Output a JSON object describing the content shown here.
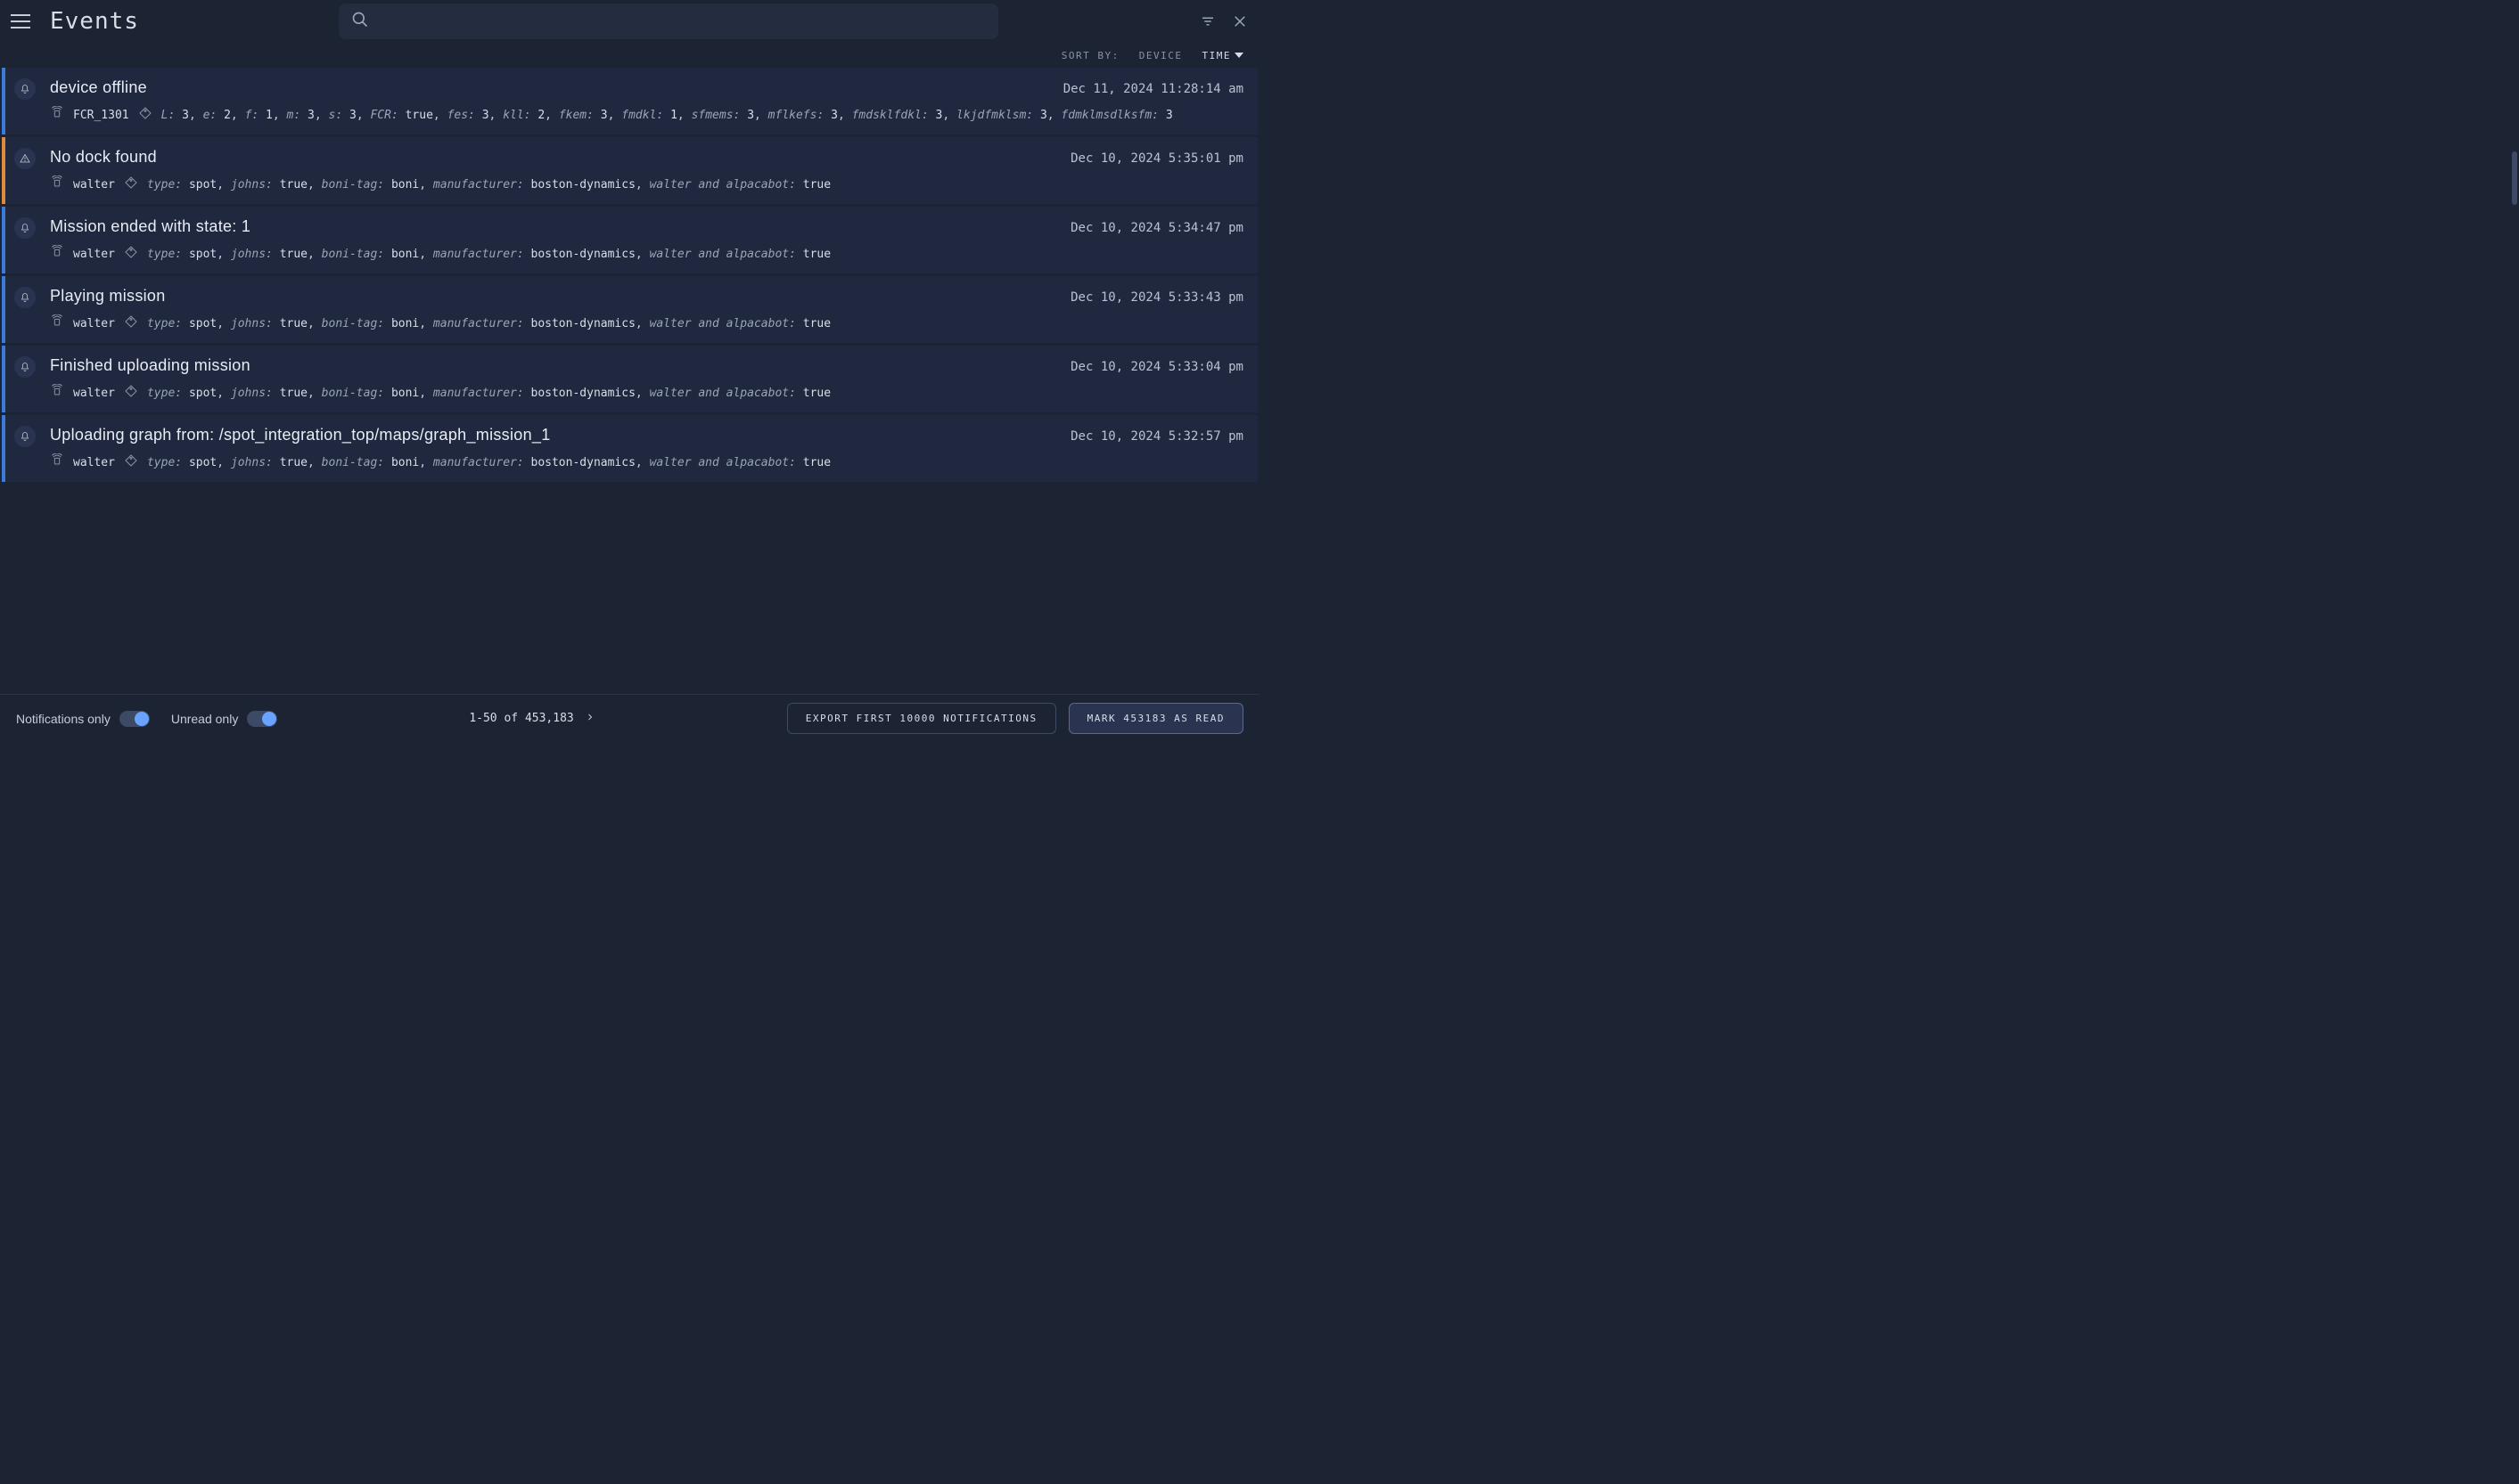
{
  "header": {
    "title": "Events",
    "search_placeholder": ""
  },
  "sortbar": {
    "label": "SORT BY:",
    "device": "DEVICE",
    "time": "TIME"
  },
  "events": [
    {
      "accent": "blue",
      "icon": "bell",
      "title": "device offline",
      "time": "Dec 11, 2024 11:28:14 am",
      "device": "FCR_1301",
      "tags": [
        {
          "k": "L",
          "v": "3"
        },
        {
          "k": "e",
          "v": "2"
        },
        {
          "k": "f",
          "v": "1"
        },
        {
          "k": "m",
          "v": "3"
        },
        {
          "k": "s",
          "v": "3"
        },
        {
          "k": "FCR",
          "v": "true"
        },
        {
          "k": "fes",
          "v": "3"
        },
        {
          "k": "kll",
          "v": "2"
        },
        {
          "k": "fkem",
          "v": "3"
        },
        {
          "k": "fmdkl",
          "v": "1"
        },
        {
          "k": "sfmems",
          "v": "3"
        },
        {
          "k": "mflkefs",
          "v": "3"
        },
        {
          "k": "fmdsklfdkl",
          "v": "3"
        },
        {
          "k": "lkjdfmklsm",
          "v": "3"
        },
        {
          "k": "fdmklmsdlksfm",
          "v": "3"
        }
      ]
    },
    {
      "accent": "orange",
      "icon": "warning",
      "title": "No dock found",
      "time": "Dec 10, 2024 5:35:01 pm",
      "device": "walter",
      "tags": [
        {
          "k": "type",
          "v": "spot"
        },
        {
          "k": "johns",
          "v": "true"
        },
        {
          "k": "boni-tag",
          "v": "boni"
        },
        {
          "k": "manufacturer",
          "v": "boston-dynamics"
        },
        {
          "k": "walter and alpacabot",
          "v": "true"
        }
      ]
    },
    {
      "accent": "blue",
      "icon": "bell",
      "title": "Mission ended with state: 1",
      "time": "Dec 10, 2024 5:34:47 pm",
      "device": "walter",
      "tags": [
        {
          "k": "type",
          "v": "spot"
        },
        {
          "k": "johns",
          "v": "true"
        },
        {
          "k": "boni-tag",
          "v": "boni"
        },
        {
          "k": "manufacturer",
          "v": "boston-dynamics"
        },
        {
          "k": "walter and alpacabot",
          "v": "true"
        }
      ]
    },
    {
      "accent": "blue",
      "icon": "bell",
      "title": "Playing mission",
      "time": "Dec 10, 2024 5:33:43 pm",
      "device": "walter",
      "tags": [
        {
          "k": "type",
          "v": "spot"
        },
        {
          "k": "johns",
          "v": "true"
        },
        {
          "k": "boni-tag",
          "v": "boni"
        },
        {
          "k": "manufacturer",
          "v": "boston-dynamics"
        },
        {
          "k": "walter and alpacabot",
          "v": "true"
        }
      ]
    },
    {
      "accent": "blue",
      "icon": "bell",
      "title": "Finished uploading mission",
      "time": "Dec 10, 2024 5:33:04 pm",
      "device": "walter",
      "tags": [
        {
          "k": "type",
          "v": "spot"
        },
        {
          "k": "johns",
          "v": "true"
        },
        {
          "k": "boni-tag",
          "v": "boni"
        },
        {
          "k": "manufacturer",
          "v": "boston-dynamics"
        },
        {
          "k": "walter and alpacabot",
          "v": "true"
        }
      ]
    },
    {
      "accent": "blue",
      "icon": "bell",
      "title": "Uploading graph from: /spot_integration_top/maps/graph_mission_1",
      "time": "Dec 10, 2024 5:32:57 pm",
      "device": "walter",
      "tags": [
        {
          "k": "type",
          "v": "spot"
        },
        {
          "k": "johns",
          "v": "true"
        },
        {
          "k": "boni-tag",
          "v": "boni"
        },
        {
          "k": "manufacturer",
          "v": "boston-dynamics"
        },
        {
          "k": "walter and alpacabot",
          "v": "true"
        }
      ]
    }
  ],
  "footer": {
    "notifications_only": "Notifications only",
    "unread_only": "Unread only",
    "pagination": "1-50 of 453,183",
    "export_label": "EXPORT FIRST 10000 NOTIFICATIONS",
    "mark_read_label": "MARK 453183 AS READ"
  }
}
